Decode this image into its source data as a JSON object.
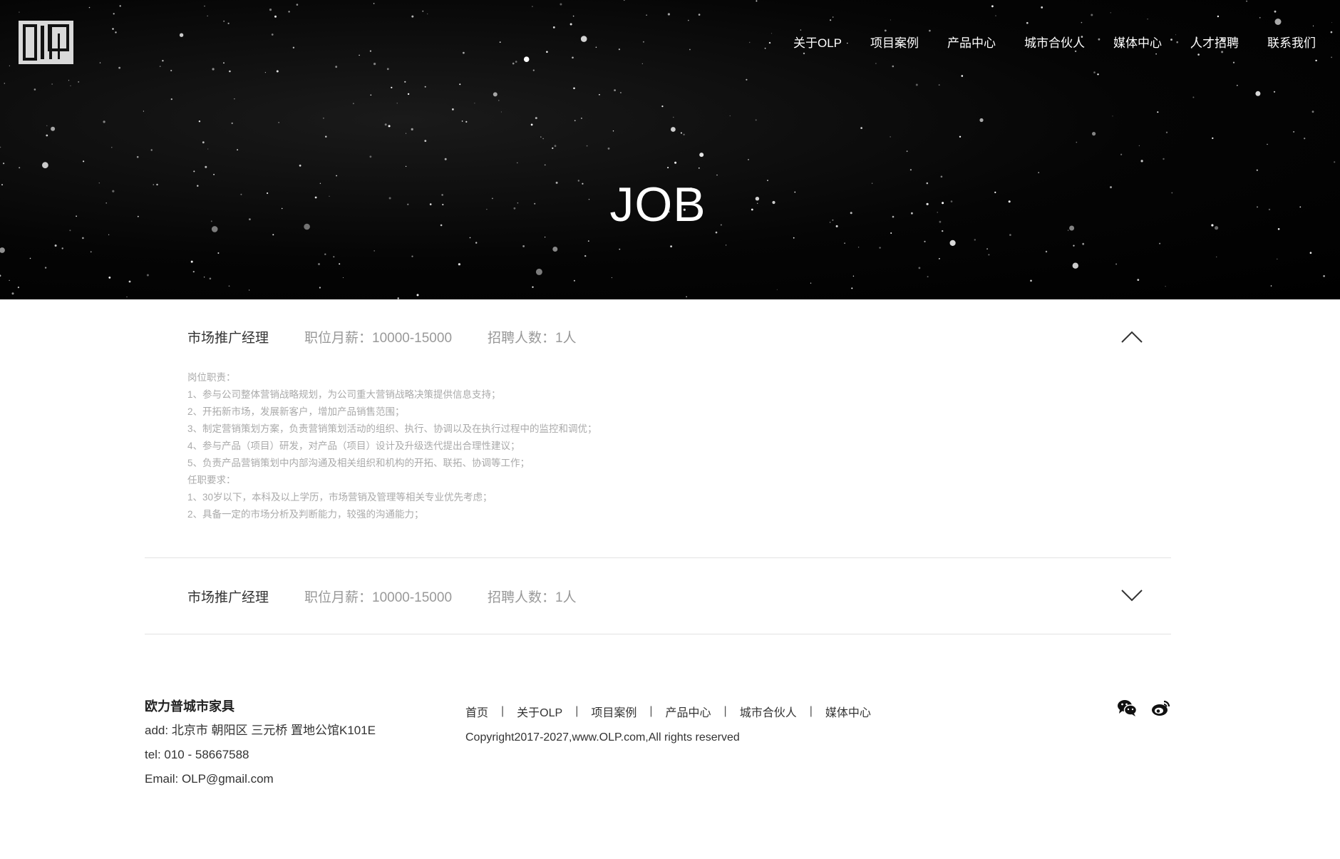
{
  "header": {
    "logo_text": "OLP",
    "nav": [
      "关于OLP",
      "项目案例",
      "产品中心",
      "城市合伙人",
      "媒体中心",
      "人才招聘",
      "联系我们"
    ]
  },
  "hero": {
    "title": "JOB"
  },
  "jobs": [
    {
      "title": "市场推广经理",
      "salary": "职位月薪：10000-15000",
      "count": "招聘人数：1人",
      "expanded": true,
      "details": [
        "岗位职责：",
        "1、参与公司整体营销战略规划，为公司重大营销战略决策提供信息支持；",
        "2、开拓新市场，发展新客户，增加产品销售范围；",
        "3、制定营销策划方案，负责营销策划活动的组织、执行、协调以及在执行过程中的监控和调优；",
        "4、参与产品（项目）研发，对产品（项目）设计及升级迭代提出合理性建议；",
        "5、负责产品营销策划中内部沟通及相关组织和机构的开拓、联拓、协调等工作；",
        "任职要求：",
        "1、30岁以下，本科及以上学历，市场营销及管理等相关专业优先考虑；",
        "2、具备一定的市场分析及判断能力，较强的沟通能力；"
      ]
    },
    {
      "title": "市场推广经理",
      "salary": "职位月薪：10000-15000",
      "count": "招聘人数：1人",
      "expanded": false
    }
  ],
  "footer": {
    "company": "欧力普城市家具",
    "address": "add: 北京市 朝阳区 三元桥 置地公馆K101E",
    "tel": "tel: 010 - 58667588",
    "email": "Email: OLP@gmail.com",
    "links": [
      "首页",
      "关于OLP",
      "项目案例",
      "产品中心",
      "城市合伙人",
      "媒体中心"
    ],
    "link_separator": "|",
    "copyright": "Copyright2017-2027,www.OLP.com,All rights reserved",
    "social_icons": [
      "wechat-icon",
      "weibo-icon"
    ]
  }
}
